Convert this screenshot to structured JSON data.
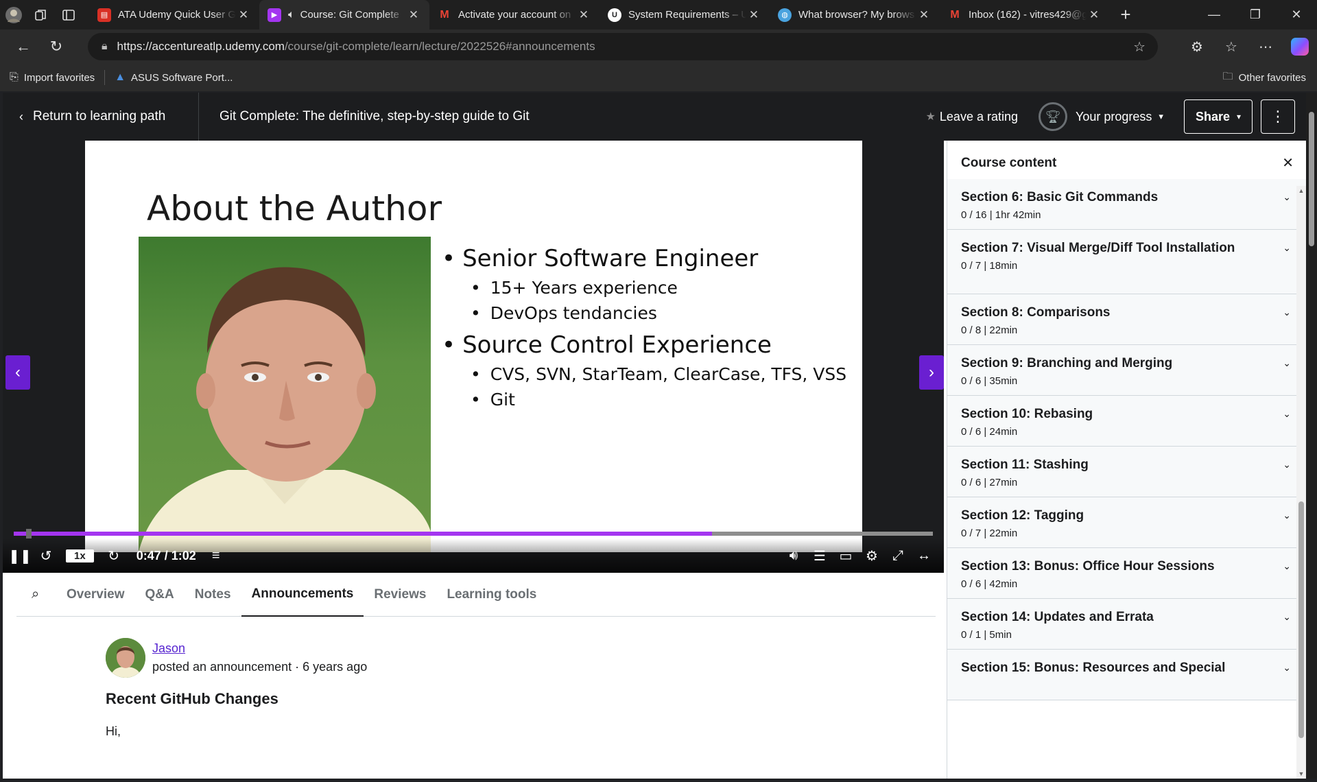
{
  "browser": {
    "tabs": [
      {
        "label": "ATA Udemy Quick User Gu",
        "favicon": "pdf-icon",
        "color": "#d93025"
      },
      {
        "label": "Course: Git Complete",
        "favicon": "udemy-icon",
        "color": "#a435f0",
        "active": true
      },
      {
        "label": "Activate your account on",
        "favicon": "gmail-icon",
        "color": "#ea4335"
      },
      {
        "label": "System Requirements – U",
        "favicon": "udemy-circle-icon",
        "color": "#ffffff"
      },
      {
        "label": "What browser? My brows",
        "favicon": "globe-icon",
        "color": "#4aa3df"
      },
      {
        "label": "Inbox (162) - vitres429@g",
        "favicon": "gmail-icon",
        "color": "#ea4335"
      }
    ],
    "url_host": "https://accentureatlp.udemy.com",
    "url_path": "/course/git-complete/learn/lecture/2022526#announcements",
    "favorites": [
      {
        "label": "Import favorites",
        "icon": "import-icon"
      },
      {
        "label": "ASUS Software Port...",
        "icon": "asus-icon"
      }
    ],
    "other_favorites": "Other favorites"
  },
  "header": {
    "back_label": "Return to learning path",
    "course_title": "Git Complete: The definitive, step-by-step guide to Git",
    "rating_label": "Leave a rating",
    "progress_label": "Your progress",
    "share_label": "Share"
  },
  "video": {
    "slide_title": "About the Author",
    "bullets": [
      {
        "text": "Senior Software Engineer",
        "sub": [
          "15+ Years experience",
          "DevOps tendancies"
        ]
      },
      {
        "text": "Source Control Experience",
        "sub": [
          "CVS, SVN, StarTeam, ClearCase, TFS, VSS",
          "Git"
        ]
      }
    ],
    "speed": "1x",
    "time": "0:47 / 1:02",
    "progress_fraction": 0.76
  },
  "tabs": [
    {
      "label": "Overview"
    },
    {
      "label": "Q&A"
    },
    {
      "label": "Notes"
    },
    {
      "label": "Announcements",
      "active": true
    },
    {
      "label": "Reviews"
    },
    {
      "label": "Learning tools"
    }
  ],
  "announcement": {
    "author": "Jason",
    "meta": "posted an announcement · 6 years ago",
    "title": "Recent GitHub Changes",
    "body": "Hi,"
  },
  "sidebar": {
    "title": "Course content",
    "sections": [
      {
        "title": "Section 6: Basic Git Commands",
        "meta": "0 / 16 | 1hr 42min"
      },
      {
        "title": "Section 7: Visual Merge/Diff Tool Installation",
        "meta": "0 / 7 | 18min"
      },
      {
        "title": "Section 8: Comparisons",
        "meta": "0 / 8 | 22min"
      },
      {
        "title": "Section 9: Branching and Merging",
        "meta": "0 / 6 | 35min"
      },
      {
        "title": "Section 10: Rebasing",
        "meta": "0 / 6 | 24min"
      },
      {
        "title": "Section 11: Stashing",
        "meta": "0 / 6 | 27min"
      },
      {
        "title": "Section 12: Tagging",
        "meta": "0 / 7 | 22min"
      },
      {
        "title": "Section 13: Bonus: Office Hour Sessions",
        "meta": "0 / 6 | 42min"
      },
      {
        "title": "Section 14: Updates and Errata",
        "meta": "0 / 1 | 5min"
      },
      {
        "title": "Section 15: Bonus: Resources and Special",
        "meta": ""
      }
    ]
  },
  "colors": {
    "accent": "#a435f0",
    "nav_arrow": "#6a1fd1",
    "link": "#5624d0",
    "dark_bar": "#1c1d1f"
  }
}
